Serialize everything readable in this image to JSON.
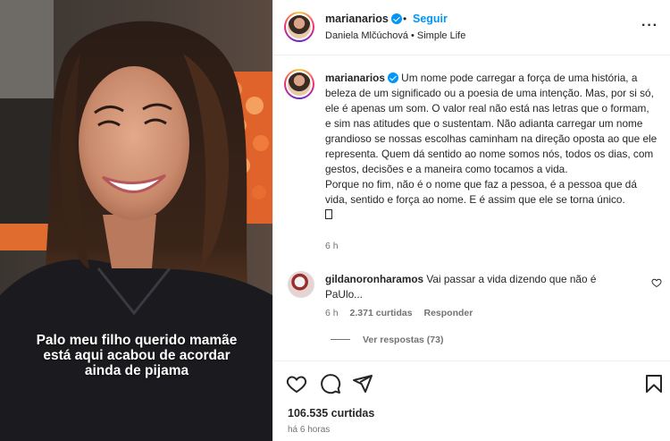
{
  "photo": {
    "caption": "Palo meu filho querido mamãe está aqui acabou de acordar ainda de pijama"
  },
  "header": {
    "username": "marianarios",
    "verified": true,
    "separator": "•",
    "follow_label": "Seguir",
    "audio": "Daniela Mlčúchová • Simple Life",
    "more_label": "···"
  },
  "post": {
    "username": "marianarios",
    "caption_p1": "Um nome pode carregar a força de uma história, a beleza de um significado ou a poesia de uma intenção. Mas, por si só, ele é apenas um som. O valor real não está nas letras que o formam, e sim nas atitudes que o sustentam. Não adianta carregar um nome grandioso se nossas escolhas caminham na direção oposta ao que ele representa. Quem dá sentido ao nome somos nós, todos os dias, com gestos, decisões e a maneira como tocamos a vida.",
    "caption_p2": "Porque no fim, não é o nome que faz a pessoa, é a pessoa que dá vida, sentido e força ao nome. E é assim que ele se torna único.",
    "time": "6 h"
  },
  "comment": {
    "username": "gildanoronharamos",
    "text": "Vai passar a vida dizendo que não é PaUlo...",
    "time": "6 h",
    "likes": "2.371 curtidas",
    "reply_label": "Responder",
    "view_replies": "Ver respostas (73)"
  },
  "footer": {
    "likes": "106.535 curtidas",
    "time_ago": "há 6 horas"
  },
  "colors": {
    "accent": "#0095f6",
    "text": "#262626",
    "muted": "#737373",
    "divider": "#efefef"
  },
  "icons": [
    "verified-badge-icon",
    "more-icon",
    "heart-icon",
    "comment-icon",
    "share-icon",
    "bookmark-icon",
    "heart-small-icon"
  ]
}
